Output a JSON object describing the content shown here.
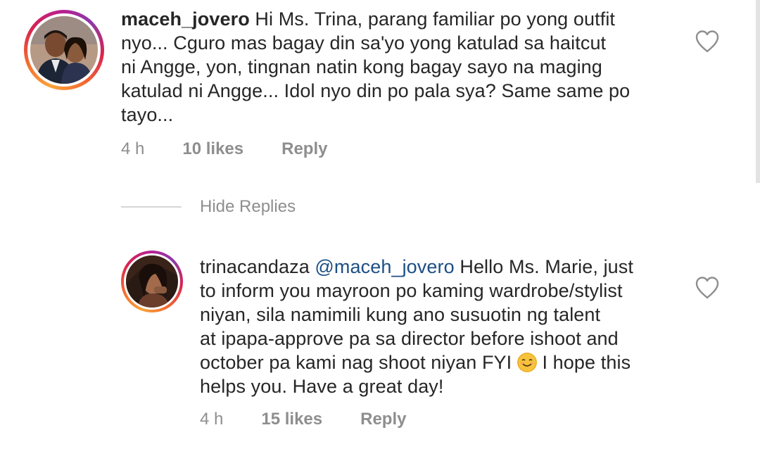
{
  "comments": [
    {
      "username": "maceh_jovero",
      "mention": "",
      "lines": [
        "Hi Ms. Trina, parang familiar po yong outfit",
        "nyo... Cguro mas bagay din sa'yo yong katulad sa haitcut",
        "ni Angge, yon, tingnan natin kong bagay sayo na maging",
        "katulad ni Angge... Idol nyo din po pala sya? Same same po",
        "tayo..."
      ],
      "time": "4 h",
      "likes": "10 likes",
      "reply": "Reply",
      "avatar_icon": "profile-photo-couple",
      "heart_icon": "heart-outline"
    }
  ],
  "hide_replies": "Hide Replies",
  "replies": [
    {
      "username": "trinacandaza",
      "mention": "@maceh_jovero",
      "first_line_rest": "Hello Ms. Marie, just",
      "lines": [
        "to inform you mayroon po kaming wardrobe/stylist",
        "niyan, sila namimili kung ano susuotin ng talent",
        "at ipapa-approve pa sa director before ishoot and"
      ],
      "fyi_line_before_emoji": "october pa kami nag shoot niyan FYI",
      "fyi_line_after_emoji": "I hope this",
      "last_line": "helps you. Have a great day!",
      "emoji": "smiling-face-emoji",
      "time": "4 h",
      "likes": "15 likes",
      "reply": "Reply",
      "avatar_icon": "profile-photo-woman",
      "heart_icon": "heart-outline"
    }
  ],
  "colors": {
    "text": "#262626",
    "meta": "#8e8e8e",
    "mention": "#1c4f84",
    "story_ring_start": "#f9a33a",
    "story_ring_end": "#b8208f"
  }
}
